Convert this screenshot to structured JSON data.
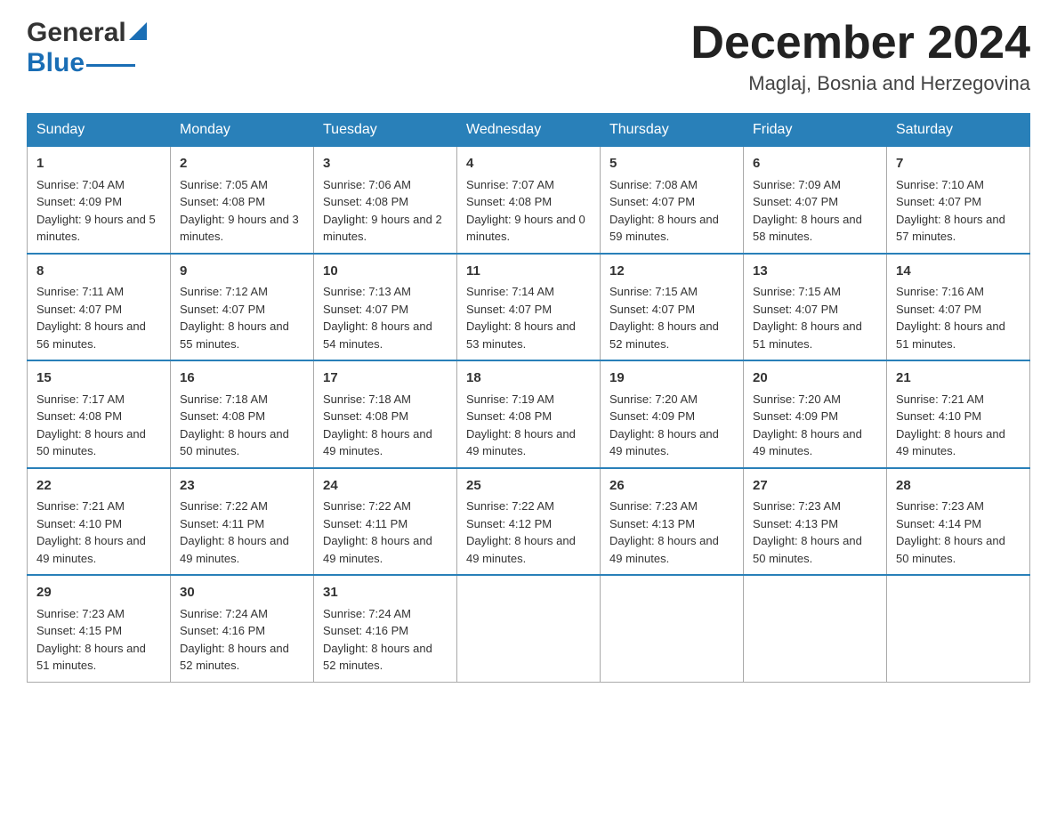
{
  "logo": {
    "general": "General",
    "blue": "Blue"
  },
  "title": "December 2024",
  "location": "Maglaj, Bosnia and Herzegovina",
  "days_of_week": [
    "Sunday",
    "Monday",
    "Tuesday",
    "Wednesday",
    "Thursday",
    "Friday",
    "Saturday"
  ],
  "weeks": [
    [
      {
        "day": "1",
        "sunrise": "7:04 AM",
        "sunset": "4:09 PM",
        "daylight": "9 hours and 5 minutes."
      },
      {
        "day": "2",
        "sunrise": "7:05 AM",
        "sunset": "4:08 PM",
        "daylight": "9 hours and 3 minutes."
      },
      {
        "day": "3",
        "sunrise": "7:06 AM",
        "sunset": "4:08 PM",
        "daylight": "9 hours and 2 minutes."
      },
      {
        "day": "4",
        "sunrise": "7:07 AM",
        "sunset": "4:08 PM",
        "daylight": "9 hours and 0 minutes."
      },
      {
        "day": "5",
        "sunrise": "7:08 AM",
        "sunset": "4:07 PM",
        "daylight": "8 hours and 59 minutes."
      },
      {
        "day": "6",
        "sunrise": "7:09 AM",
        "sunset": "4:07 PM",
        "daylight": "8 hours and 58 minutes."
      },
      {
        "day": "7",
        "sunrise": "7:10 AM",
        "sunset": "4:07 PM",
        "daylight": "8 hours and 57 minutes."
      }
    ],
    [
      {
        "day": "8",
        "sunrise": "7:11 AM",
        "sunset": "4:07 PM",
        "daylight": "8 hours and 56 minutes."
      },
      {
        "day": "9",
        "sunrise": "7:12 AM",
        "sunset": "4:07 PM",
        "daylight": "8 hours and 55 minutes."
      },
      {
        "day": "10",
        "sunrise": "7:13 AM",
        "sunset": "4:07 PM",
        "daylight": "8 hours and 54 minutes."
      },
      {
        "day": "11",
        "sunrise": "7:14 AM",
        "sunset": "4:07 PM",
        "daylight": "8 hours and 53 minutes."
      },
      {
        "day": "12",
        "sunrise": "7:15 AM",
        "sunset": "4:07 PM",
        "daylight": "8 hours and 52 minutes."
      },
      {
        "day": "13",
        "sunrise": "7:15 AM",
        "sunset": "4:07 PM",
        "daylight": "8 hours and 51 minutes."
      },
      {
        "day": "14",
        "sunrise": "7:16 AM",
        "sunset": "4:07 PM",
        "daylight": "8 hours and 51 minutes."
      }
    ],
    [
      {
        "day": "15",
        "sunrise": "7:17 AM",
        "sunset": "4:08 PM",
        "daylight": "8 hours and 50 minutes."
      },
      {
        "day": "16",
        "sunrise": "7:18 AM",
        "sunset": "4:08 PM",
        "daylight": "8 hours and 50 minutes."
      },
      {
        "day": "17",
        "sunrise": "7:18 AM",
        "sunset": "4:08 PM",
        "daylight": "8 hours and 49 minutes."
      },
      {
        "day": "18",
        "sunrise": "7:19 AM",
        "sunset": "4:08 PM",
        "daylight": "8 hours and 49 minutes."
      },
      {
        "day": "19",
        "sunrise": "7:20 AM",
        "sunset": "4:09 PM",
        "daylight": "8 hours and 49 minutes."
      },
      {
        "day": "20",
        "sunrise": "7:20 AM",
        "sunset": "4:09 PM",
        "daylight": "8 hours and 49 minutes."
      },
      {
        "day": "21",
        "sunrise": "7:21 AM",
        "sunset": "4:10 PM",
        "daylight": "8 hours and 49 minutes."
      }
    ],
    [
      {
        "day": "22",
        "sunrise": "7:21 AM",
        "sunset": "4:10 PM",
        "daylight": "8 hours and 49 minutes."
      },
      {
        "day": "23",
        "sunrise": "7:22 AM",
        "sunset": "4:11 PM",
        "daylight": "8 hours and 49 minutes."
      },
      {
        "day": "24",
        "sunrise": "7:22 AM",
        "sunset": "4:11 PM",
        "daylight": "8 hours and 49 minutes."
      },
      {
        "day": "25",
        "sunrise": "7:22 AM",
        "sunset": "4:12 PM",
        "daylight": "8 hours and 49 minutes."
      },
      {
        "day": "26",
        "sunrise": "7:23 AM",
        "sunset": "4:13 PM",
        "daylight": "8 hours and 49 minutes."
      },
      {
        "day": "27",
        "sunrise": "7:23 AM",
        "sunset": "4:13 PM",
        "daylight": "8 hours and 50 minutes."
      },
      {
        "day": "28",
        "sunrise": "7:23 AM",
        "sunset": "4:14 PM",
        "daylight": "8 hours and 50 minutes."
      }
    ],
    [
      {
        "day": "29",
        "sunrise": "7:23 AM",
        "sunset": "4:15 PM",
        "daylight": "8 hours and 51 minutes."
      },
      {
        "day": "30",
        "sunrise": "7:24 AM",
        "sunset": "4:16 PM",
        "daylight": "8 hours and 52 minutes."
      },
      {
        "day": "31",
        "sunrise": "7:24 AM",
        "sunset": "4:16 PM",
        "daylight": "8 hours and 52 minutes."
      },
      null,
      null,
      null,
      null
    ]
  ],
  "labels": {
    "sunrise": "Sunrise:",
    "sunset": "Sunset:",
    "daylight": "Daylight:"
  }
}
